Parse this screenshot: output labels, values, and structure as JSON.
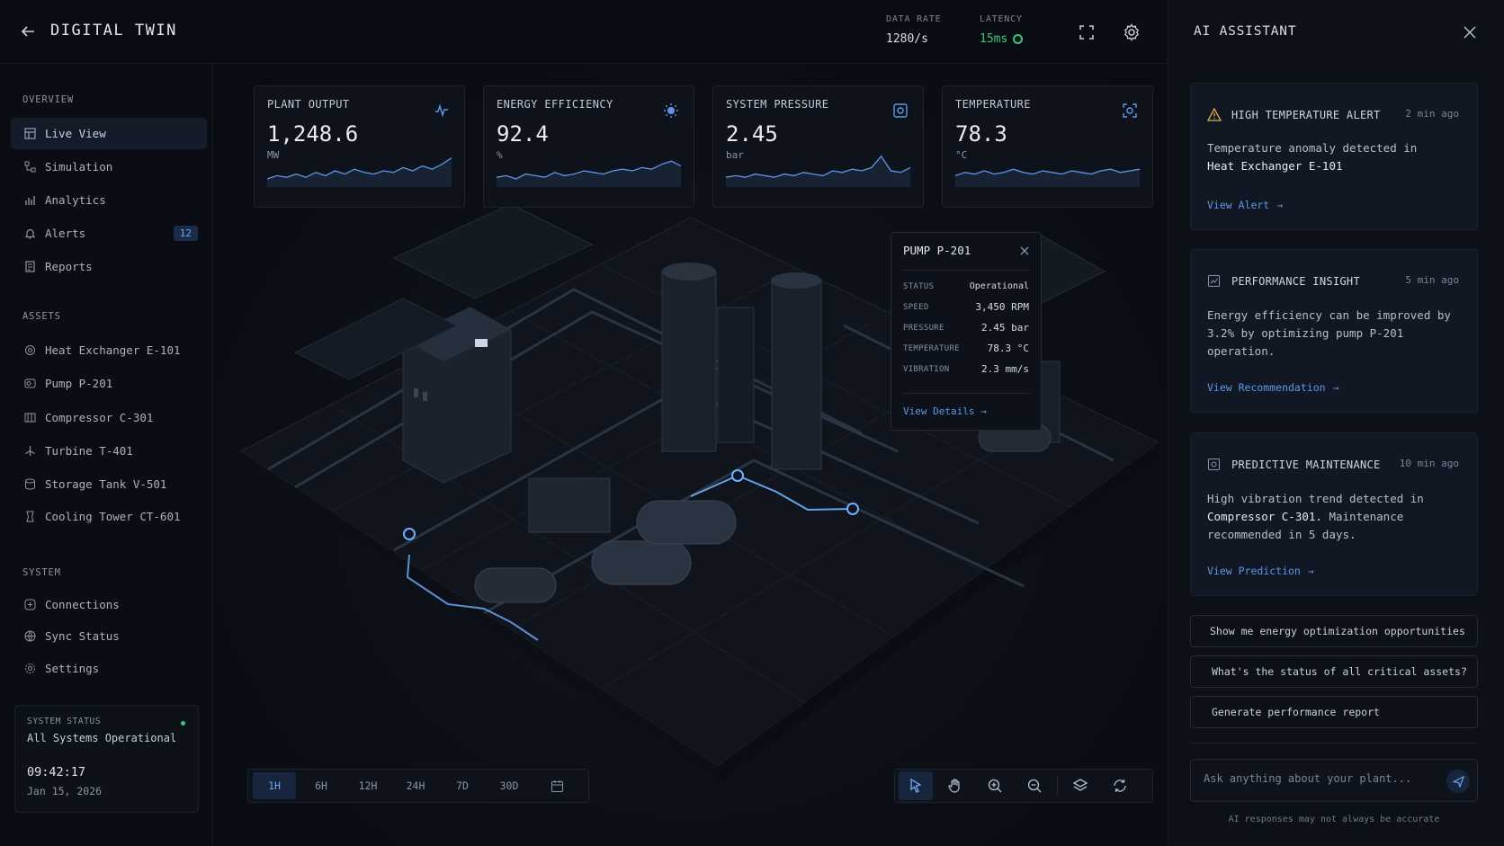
{
  "header": {
    "title": "DIGITAL TWIN",
    "data_rate": {
      "label": "DATA RATE",
      "value": "1280/s"
    },
    "latency": {
      "label": "LATENCY",
      "value": "15ms"
    }
  },
  "sidebar": {
    "overview_title": "OVERVIEW",
    "overview_items": [
      {
        "label": "Live View",
        "icon": "map-icon"
      },
      {
        "label": "Simulation",
        "icon": "flow-icon"
      },
      {
        "label": "Analytics",
        "icon": "bar-chart-icon"
      },
      {
        "label": "Alerts",
        "icon": "bell-icon",
        "badge": "12"
      },
      {
        "label": "Reports",
        "icon": "report-icon"
      }
    ],
    "assets_title": "ASSETS",
    "asset_items": [
      {
        "label": "Heat Exchanger E-101"
      },
      {
        "label": "Pump P-201"
      },
      {
        "label": "Compressor C-301"
      },
      {
        "label": "Turbine T-401"
      },
      {
        "label": "Storage Tank V-501"
      },
      {
        "label": "Cooling Tower CT-601"
      }
    ],
    "system_title": "SYSTEM",
    "system_items": [
      {
        "label": "Connections"
      },
      {
        "label": "Sync Status"
      },
      {
        "label": "Settings"
      }
    ],
    "status": {
      "label": "SYSTEM STATUS",
      "text": "All Systems Operational",
      "time": "09:42:17",
      "date": "Jan 15, 2026"
    }
  },
  "kpis": [
    {
      "label": "PLANT OUTPUT",
      "value": "1,248.6",
      "unit": "MW",
      "icon": "activity-icon",
      "spark": [
        0.25,
        0.35,
        0.3,
        0.4,
        0.3,
        0.45,
        0.35,
        0.5,
        0.4,
        0.55,
        0.45,
        0.4,
        0.5,
        0.45,
        0.6,
        0.5,
        0.65,
        0.55,
        0.7,
        0.9
      ]
    },
    {
      "label": "ENERGY EFFICIENCY",
      "value": "92.4",
      "unit": "%",
      "icon": "sun-icon",
      "spark": [
        0.3,
        0.35,
        0.25,
        0.4,
        0.35,
        0.3,
        0.45,
        0.35,
        0.4,
        0.5,
        0.45,
        0.4,
        0.5,
        0.55,
        0.5,
        0.6,
        0.55,
        0.7,
        0.8,
        0.65
      ]
    },
    {
      "label": "SYSTEM PRESSURE",
      "value": "2.45",
      "unit": "bar",
      "icon": "gauge-icon",
      "spark": [
        0.3,
        0.35,
        0.3,
        0.4,
        0.35,
        0.3,
        0.4,
        0.35,
        0.45,
        0.4,
        0.35,
        0.5,
        0.45,
        0.55,
        0.5,
        0.6,
        0.95,
        0.5,
        0.45,
        0.6
      ]
    },
    {
      "label": "TEMPERATURE",
      "value": "78.3",
      "unit": "°C",
      "icon": "thermo-icon",
      "spark": [
        0.35,
        0.45,
        0.4,
        0.5,
        0.4,
        0.45,
        0.55,
        0.45,
        0.4,
        0.5,
        0.45,
        0.4,
        0.5,
        0.45,
        0.4,
        0.5,
        0.55,
        0.45,
        0.5,
        0.55
      ]
    }
  ],
  "popup": {
    "title": "PUMP P-201",
    "rows": [
      {
        "k": "STATUS",
        "v": "Operational"
      },
      {
        "k": "SPEED",
        "v": "3,450 RPM"
      },
      {
        "k": "PRESSURE",
        "v": "2.45 bar"
      },
      {
        "k": "TEMPERATURE",
        "v": "78.3 °C"
      },
      {
        "k": "VIBRATION",
        "v": "2.3 mm/s"
      }
    ],
    "link": "View Details"
  },
  "timebar": [
    "1H",
    "6H",
    "12H",
    "24H",
    "7D",
    "30D"
  ],
  "assistant": {
    "title": "AI ASSISTANT",
    "cards": [
      {
        "title": "HIGH TEMPERATURE ALERT",
        "ago": "2 min ago",
        "body_pre": "Temperature anomaly detected in",
        "body_bold": "Heat Exchanger E-101",
        "body_post": "",
        "link": "View Alert"
      },
      {
        "title": "PERFORMANCE INSIGHT",
        "ago": "5 min ago",
        "body_pre": "Energy efficiency can be improved by 3.2% by optimizing pump P-201 operation.",
        "body_bold": "",
        "body_post": "",
        "link": "View Recommendation"
      },
      {
        "title": "PREDICTIVE MAINTENANCE",
        "ago": "10 min ago",
        "body_pre": "High vibration trend detected in",
        "body_bold": "Compressor C-301.",
        "body_post": "Maintenance recommended in 5 days.",
        "link": "View Prediction"
      }
    ],
    "suggestions": [
      "Show me energy optimization opportunities",
      "What's the status of all critical assets?",
      "Generate performance report"
    ],
    "input_placeholder": "Ask anything about your plant...",
    "disclaimer": "AI responses may not always be accurate"
  },
  "colors": {
    "accent": "#5d97e8",
    "ok": "#34c77b",
    "warn": "#e0b34a",
    "bg": "#0a0e14"
  }
}
